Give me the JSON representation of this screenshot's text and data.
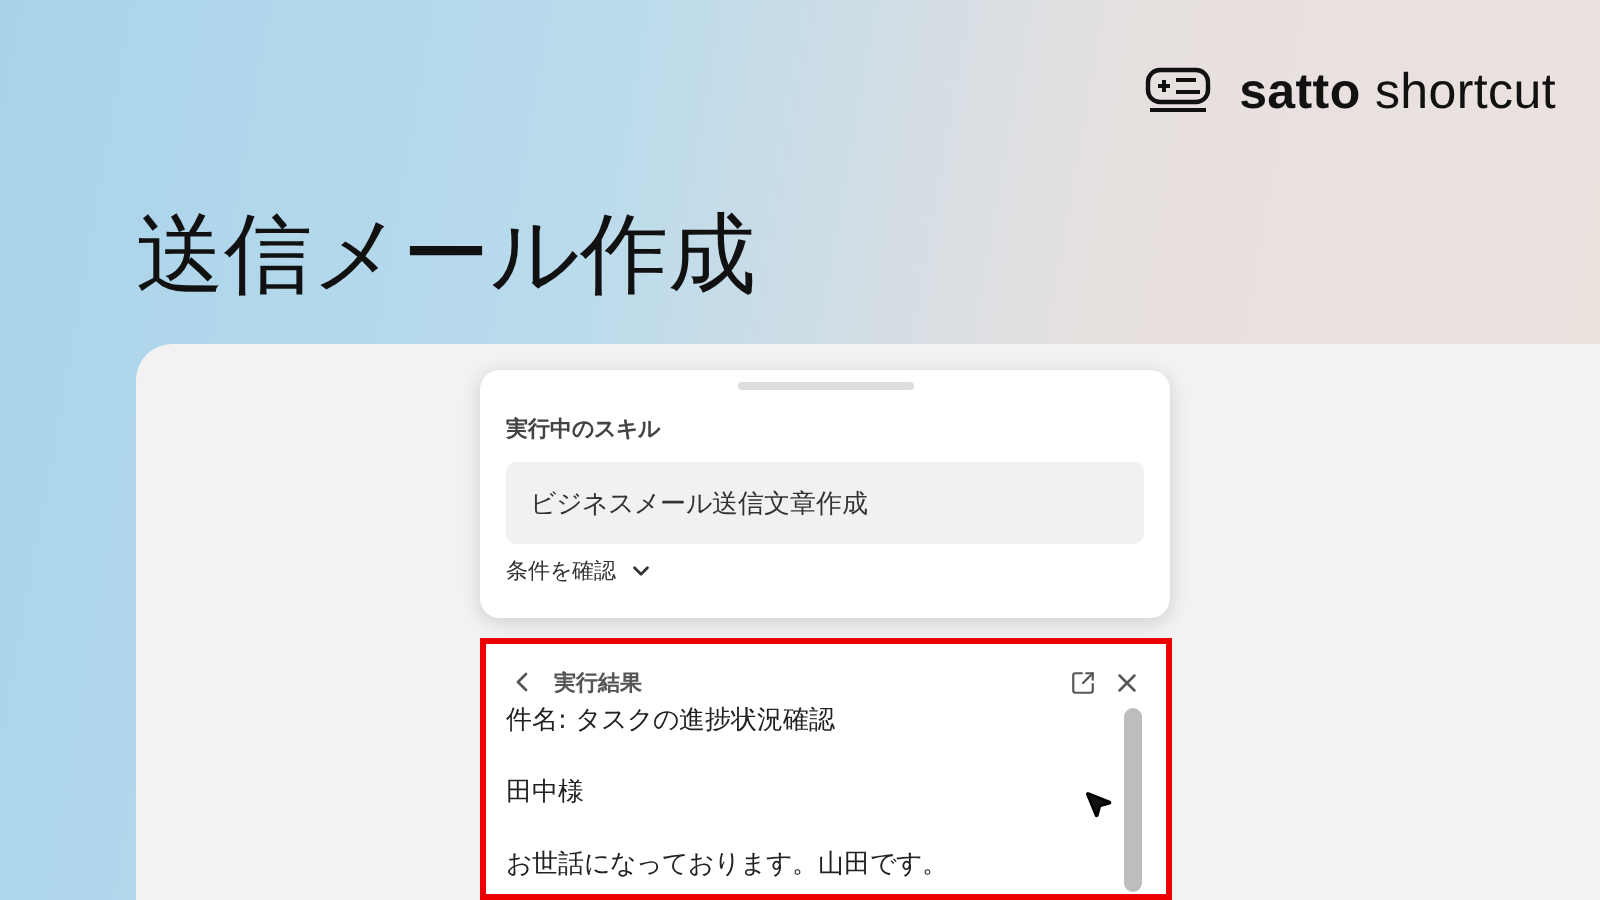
{
  "brand": {
    "name": "**satto** shortcut"
  },
  "title": "送信メール作成",
  "skill_card": {
    "heading": "実行中のスキル",
    "skill_name": "ビジネスメール送信文章作成",
    "conditions_toggle": {
      "label": "条件を確認",
      "expanded": false
    }
  },
  "result_panel": {
    "title": "実行結果",
    "highlighted": true,
    "paragraphs": [
      "件名: タスクの進捗状況確認",
      "田中様",
      "お世話になっております。山田です。"
    ]
  }
}
